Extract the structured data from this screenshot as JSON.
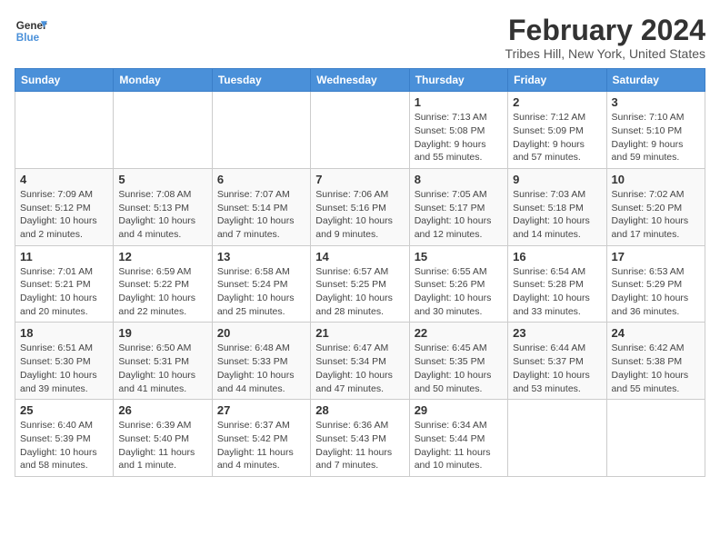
{
  "header": {
    "logo_line1": "General",
    "logo_line2": "Blue",
    "month_title": "February 2024",
    "location": "Tribes Hill, New York, United States"
  },
  "days_of_week": [
    "Sunday",
    "Monday",
    "Tuesday",
    "Wednesday",
    "Thursday",
    "Friday",
    "Saturday"
  ],
  "weeks": [
    [
      {
        "day": "",
        "info": ""
      },
      {
        "day": "",
        "info": ""
      },
      {
        "day": "",
        "info": ""
      },
      {
        "day": "",
        "info": ""
      },
      {
        "day": "1",
        "info": "Sunrise: 7:13 AM\nSunset: 5:08 PM\nDaylight: 9 hours\nand 55 minutes."
      },
      {
        "day": "2",
        "info": "Sunrise: 7:12 AM\nSunset: 5:09 PM\nDaylight: 9 hours\nand 57 minutes."
      },
      {
        "day": "3",
        "info": "Sunrise: 7:10 AM\nSunset: 5:10 PM\nDaylight: 9 hours\nand 59 minutes."
      }
    ],
    [
      {
        "day": "4",
        "info": "Sunrise: 7:09 AM\nSunset: 5:12 PM\nDaylight: 10 hours\nand 2 minutes."
      },
      {
        "day": "5",
        "info": "Sunrise: 7:08 AM\nSunset: 5:13 PM\nDaylight: 10 hours\nand 4 minutes."
      },
      {
        "day": "6",
        "info": "Sunrise: 7:07 AM\nSunset: 5:14 PM\nDaylight: 10 hours\nand 7 minutes."
      },
      {
        "day": "7",
        "info": "Sunrise: 7:06 AM\nSunset: 5:16 PM\nDaylight: 10 hours\nand 9 minutes."
      },
      {
        "day": "8",
        "info": "Sunrise: 7:05 AM\nSunset: 5:17 PM\nDaylight: 10 hours\nand 12 minutes."
      },
      {
        "day": "9",
        "info": "Sunrise: 7:03 AM\nSunset: 5:18 PM\nDaylight: 10 hours\nand 14 minutes."
      },
      {
        "day": "10",
        "info": "Sunrise: 7:02 AM\nSunset: 5:20 PM\nDaylight: 10 hours\nand 17 minutes."
      }
    ],
    [
      {
        "day": "11",
        "info": "Sunrise: 7:01 AM\nSunset: 5:21 PM\nDaylight: 10 hours\nand 20 minutes."
      },
      {
        "day": "12",
        "info": "Sunrise: 6:59 AM\nSunset: 5:22 PM\nDaylight: 10 hours\nand 22 minutes."
      },
      {
        "day": "13",
        "info": "Sunrise: 6:58 AM\nSunset: 5:24 PM\nDaylight: 10 hours\nand 25 minutes."
      },
      {
        "day": "14",
        "info": "Sunrise: 6:57 AM\nSunset: 5:25 PM\nDaylight: 10 hours\nand 28 minutes."
      },
      {
        "day": "15",
        "info": "Sunrise: 6:55 AM\nSunset: 5:26 PM\nDaylight: 10 hours\nand 30 minutes."
      },
      {
        "day": "16",
        "info": "Sunrise: 6:54 AM\nSunset: 5:28 PM\nDaylight: 10 hours\nand 33 minutes."
      },
      {
        "day": "17",
        "info": "Sunrise: 6:53 AM\nSunset: 5:29 PM\nDaylight: 10 hours\nand 36 minutes."
      }
    ],
    [
      {
        "day": "18",
        "info": "Sunrise: 6:51 AM\nSunset: 5:30 PM\nDaylight: 10 hours\nand 39 minutes."
      },
      {
        "day": "19",
        "info": "Sunrise: 6:50 AM\nSunset: 5:31 PM\nDaylight: 10 hours\nand 41 minutes."
      },
      {
        "day": "20",
        "info": "Sunrise: 6:48 AM\nSunset: 5:33 PM\nDaylight: 10 hours\nand 44 minutes."
      },
      {
        "day": "21",
        "info": "Sunrise: 6:47 AM\nSunset: 5:34 PM\nDaylight: 10 hours\nand 47 minutes."
      },
      {
        "day": "22",
        "info": "Sunrise: 6:45 AM\nSunset: 5:35 PM\nDaylight: 10 hours\nand 50 minutes."
      },
      {
        "day": "23",
        "info": "Sunrise: 6:44 AM\nSunset: 5:37 PM\nDaylight: 10 hours\nand 53 minutes."
      },
      {
        "day": "24",
        "info": "Sunrise: 6:42 AM\nSunset: 5:38 PM\nDaylight: 10 hours\nand 55 minutes."
      }
    ],
    [
      {
        "day": "25",
        "info": "Sunrise: 6:40 AM\nSunset: 5:39 PM\nDaylight: 10 hours\nand 58 minutes."
      },
      {
        "day": "26",
        "info": "Sunrise: 6:39 AM\nSunset: 5:40 PM\nDaylight: 11 hours\nand 1 minute."
      },
      {
        "day": "27",
        "info": "Sunrise: 6:37 AM\nSunset: 5:42 PM\nDaylight: 11 hours\nand 4 minutes."
      },
      {
        "day": "28",
        "info": "Sunrise: 6:36 AM\nSunset: 5:43 PM\nDaylight: 11 hours\nand 7 minutes."
      },
      {
        "day": "29",
        "info": "Sunrise: 6:34 AM\nSunset: 5:44 PM\nDaylight: 11 hours\nand 10 minutes."
      },
      {
        "day": "",
        "info": ""
      },
      {
        "day": "",
        "info": ""
      }
    ]
  ]
}
